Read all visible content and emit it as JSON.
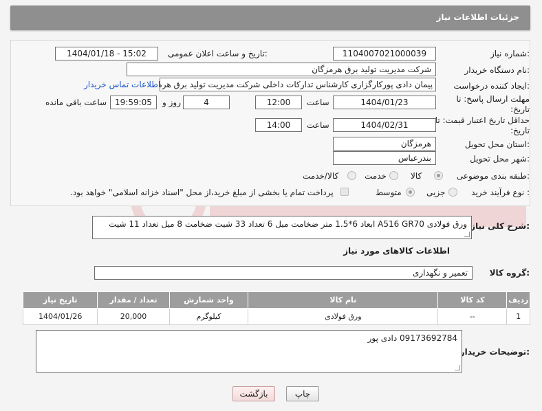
{
  "page": {
    "title": "جزئیات اطلاعات نیاز"
  },
  "form": {
    "need_number_label": "شماره نیاز:",
    "need_number": "1104007021000039",
    "announce_label": "تاریخ و ساعت اعلان عمومی:",
    "announce_value": "1404/01/18 - 15:02",
    "buyer_org_label": "نام دستگاه خریدار:",
    "buyer_org": "شرکت مدیریت تولید برق هرمزگان",
    "creator_label": "ایجاد کننده درخواست:",
    "creator": "پیمان دادی پورکارگزاری کارشناس تدارکات داخلی شرکت مدیریت تولید برق هرمزگان",
    "contact_link": "اطلاعات تماس خریدار",
    "deadline_label": "مهلت ارسال پاسخ: تا تاریخ:",
    "deadline_date": "1404/01/23",
    "time_label": "ساعت",
    "deadline_time": "12:00",
    "days_value": "4",
    "days_label": "روز و",
    "remaining_time": "19:59:05",
    "remaining_label": "ساعت باقی مانده",
    "min_price_label": "حداقل تاریخ اعتبار قیمت: تا تاریخ:",
    "min_price_date": "1404/02/31",
    "min_price_time": "14:00",
    "province_label": "استان محل تحویل:",
    "province": "هرمزگان",
    "city_label": "شهر محل تحویل:",
    "city": "بندرعباس",
    "category_label": "طبقه بندی موضوعی:",
    "category_options": [
      "کالا",
      "خدمت",
      "کالا/خدمت"
    ],
    "process_label": "نوع فرآیند خرید :",
    "process_options": [
      "جزیی",
      "متوسط"
    ],
    "payment_note": "پرداخت تمام یا بخشی از مبلغ خرید،از محل \"اسناد خزانه اسلامی\" خواهد بود."
  },
  "description": {
    "label": "شرح کلی نیاز:",
    "text": "ورق فولادی A516 GR70 ابعاد 6*1.5 متر ضخامت  میل 6 تعداد 33 شیت ضخامت 8 میل تعداد 11 شیت"
  },
  "goods": {
    "section_title": "اطلاعات کالاهای مورد نیاز",
    "group_label": "گروه کالا:",
    "group_value": "تعمیر و نگهداری",
    "columns": [
      "ردیف",
      "کد کالا",
      "نام کالا",
      "واحد شمارش",
      "تعداد / مقدار",
      "تاریخ نیاز"
    ],
    "rows": [
      [
        "1",
        "--",
        "ورق فولادی",
        "کیلوگرم",
        "20,000",
        "1404/01/26"
      ]
    ]
  },
  "buyer_notes": {
    "label": "توضیحات خریدار:",
    "text": "09173692784 دادی پور"
  },
  "buttons": {
    "print": "چاپ",
    "back": "بازگشت"
  },
  "colors": {
    "header_bg": "#8f8f8f",
    "table_header_bg": "#9d9d9d",
    "link": "#1a56c9"
  }
}
